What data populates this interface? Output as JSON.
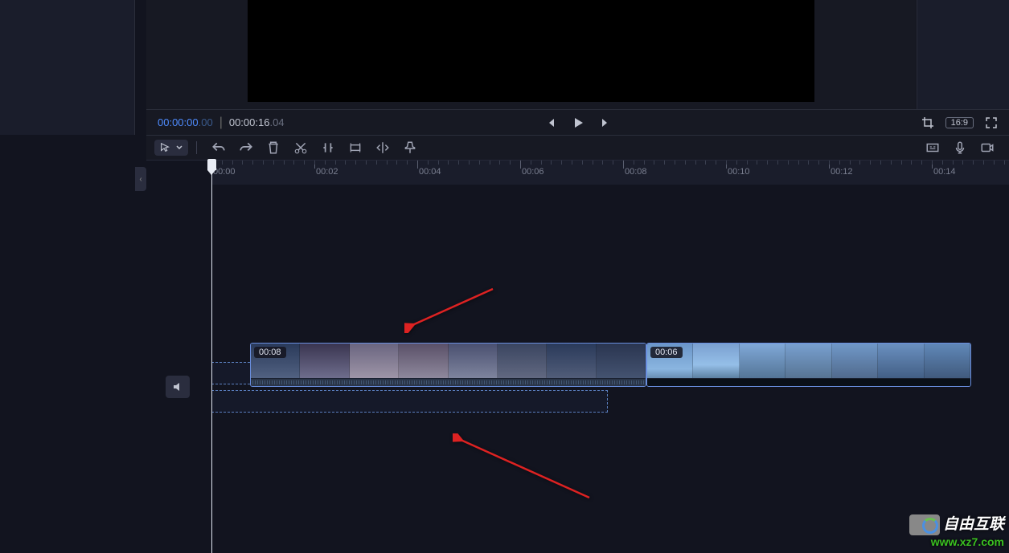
{
  "playback": {
    "current_time": "00:00:00",
    "current_frames": ".00",
    "total_time": "00:00:16",
    "total_frames": ".04",
    "aspect_ratio": "16:9"
  },
  "ruler": {
    "labels": [
      "00:00",
      "00:02",
      "00:04",
      "00:06",
      "00:08",
      "00:10",
      "00:12",
      "00:14"
    ]
  },
  "clips": [
    {
      "duration_label": "00:08"
    },
    {
      "duration_label": "00:06"
    }
  ],
  "watermark": {
    "line1": "自由互联",
    "line2": "www.xz7.com"
  },
  "icons": {
    "select": "select-tool",
    "undo": "undo",
    "redo": "redo",
    "delete": "delete",
    "cut": "cut",
    "split": "split",
    "crop_tl": "crop-timeline",
    "mirror": "mirror",
    "pin": "pin",
    "text": "auto-caption",
    "mic": "voiceover",
    "record": "record-screen",
    "crop": "crop",
    "fullscreen": "fullscreen",
    "prev": "prev-frame",
    "play": "play",
    "next": "next-frame",
    "mute": "mute",
    "collapse": "collapse-left"
  }
}
